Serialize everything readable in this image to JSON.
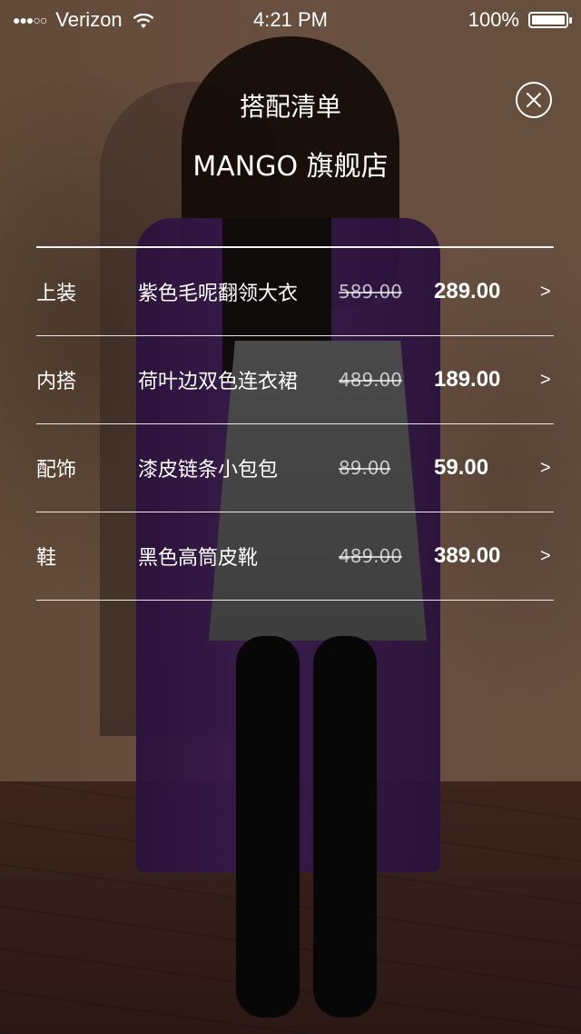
{
  "status_bar": {
    "carrier": "Verizon",
    "signal_dots": "●●●○○",
    "time": "4:21 PM",
    "battery": "100%",
    "battery_level": 1.0
  },
  "header": {
    "title": "搭配清单",
    "store": "MANGO 旗舰店"
  },
  "items": [
    {
      "category": "上装",
      "name": "紫色毛呢翻领大衣",
      "original_price": "589.00",
      "price": "289.00",
      "chevron": ">"
    },
    {
      "category": "内搭",
      "name": "荷叶边双色连衣裙",
      "original_price": "489.00",
      "price": "189.00",
      "chevron": ">"
    },
    {
      "category": "配饰",
      "name": "漆皮链条小包包",
      "original_price": "89.00",
      "price": "59.00",
      "chevron": ">"
    },
    {
      "category": "鞋",
      "name": "黑色高筒皮靴",
      "original_price": "489.00",
      "price": "389.00",
      "chevron": ">"
    }
  ],
  "icons": {
    "close": "close-icon",
    "wifi": "wifi-icon",
    "battery": "battery-icon",
    "chevron": "chevron-right-icon"
  },
  "colors": {
    "text": "#ffffff",
    "strikethrough_text": "#bfbfbf",
    "overlay": "rgba(0,0,0,0.42)"
  }
}
